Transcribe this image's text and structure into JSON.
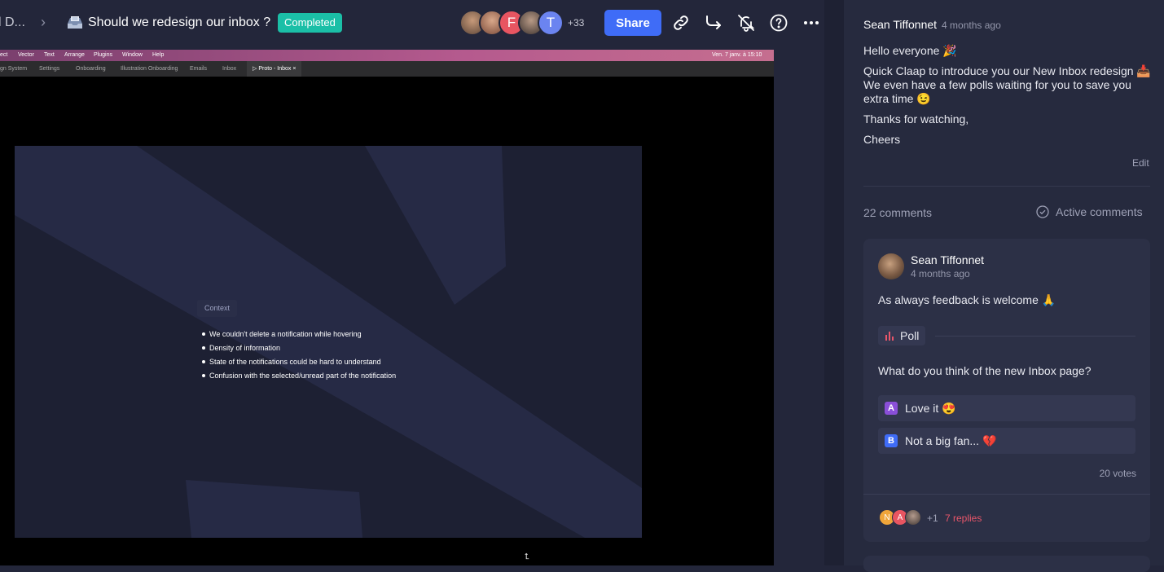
{
  "header": {
    "breadcrumb_prev": "l D...",
    "breadcrumb_sep": "›",
    "doc_icon": "inbox-tray-emoji",
    "title": "Should we redesign our inbox ?",
    "status": "Completed",
    "avatars": [
      {
        "initial": "",
        "color": "#8a6a55"
      },
      {
        "initial": "",
        "color": "#a0674f"
      },
      {
        "initial": "F",
        "color": "#e85561"
      },
      {
        "initial": "",
        "color": "#5a4a44"
      },
      {
        "initial": "T",
        "color": "#6b84f0"
      }
    ],
    "more_count": "+33",
    "share_label": "Share",
    "icons": [
      "link-icon",
      "forward-icon",
      "bell-off-icon",
      "help-icon",
      "more-icon"
    ]
  },
  "video": {
    "menubar": [
      "ect",
      "Vector",
      "Text",
      "Arrange",
      "Plugins",
      "Window",
      "Help"
    ],
    "menubar_right": "Ven. 7 janv. à 15:10",
    "tabs": [
      "gn System",
      "Settings",
      "Onboarding",
      "Illustration Onboarding",
      "Emails",
      "Inbox"
    ],
    "active_tab": "Proto - Inbox",
    "context_label": "Context",
    "bullets": [
      "We couldn't delete a notification while hovering",
      "Density of information",
      "State of the notifications could be hard to understand",
      "Confusion with the selected/unread part of the notification"
    ]
  },
  "panel": {
    "author": "Sean Tiffonnet",
    "author_time": "4 months ago",
    "description": [
      "Hello everyone 🎉",
      "Quick Claap to introduce you our New Inbox redesign 📥 We even have a few polls waiting for you to save you extra time 😉",
      "Thanks for watching,",
      "Cheers"
    ],
    "edit_label": "Edit",
    "comments_count": "22 comments",
    "active_comments_label": "Active comments",
    "comment": {
      "author": "Sean Tiffonnet",
      "time": "4 months ago",
      "text": "As always feedback is welcome 🙏",
      "poll_label": "Poll",
      "question": "What do you think of the new Inbox page?",
      "options": [
        {
          "letter": "A",
          "label": "Love it 😍",
          "color": "#8a4fd8"
        },
        {
          "letter": "B",
          "label": "Not a big fan... 💔",
          "color": "#3f6cf7"
        }
      ],
      "votes": "20 votes",
      "reply_avatars": [
        {
          "initial": "N",
          "color": "#f0a53a"
        },
        {
          "initial": "A",
          "color": "#e85561"
        },
        {
          "initial": "",
          "color": "#6a5d58"
        }
      ],
      "plus_more": "+1",
      "replies": "7 replies"
    }
  },
  "colors": {
    "accent": "#3f6cf7",
    "status_badge": "#1bbfa7",
    "replies": "#e9566a"
  }
}
